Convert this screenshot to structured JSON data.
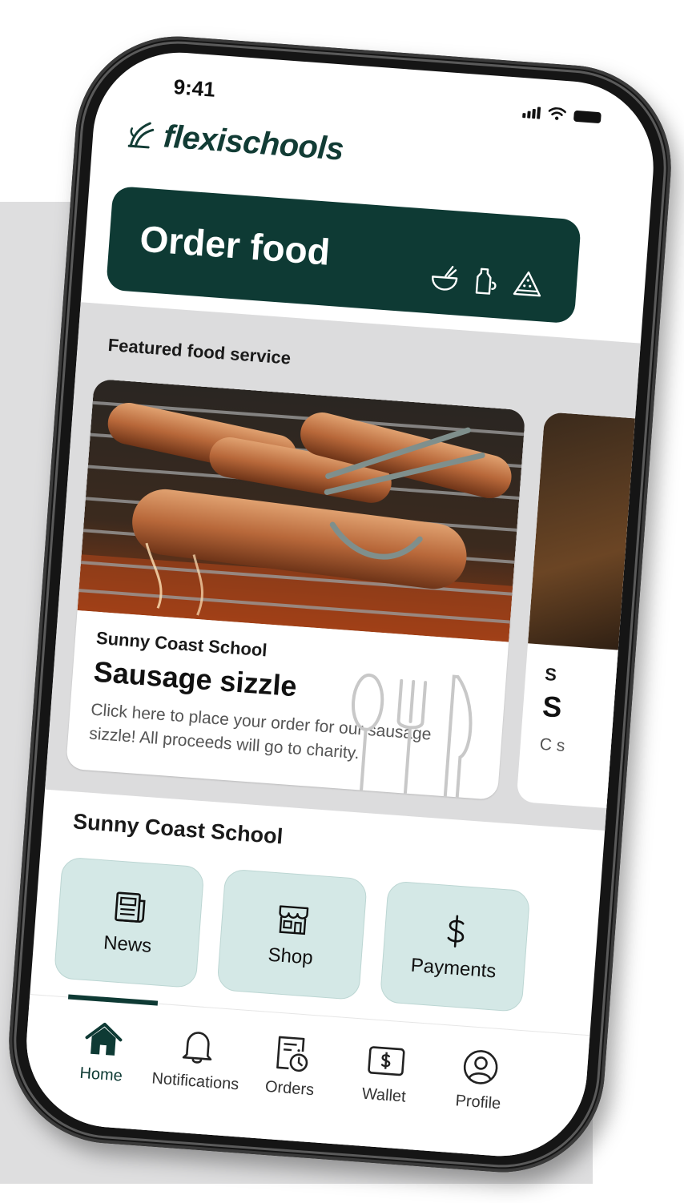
{
  "status_bar": {
    "time": "9:41"
  },
  "brand": {
    "name": "flexischools"
  },
  "order_banner": {
    "title": "Order food",
    "icons": [
      "bowl-icon",
      "bottle-icon",
      "watermelon-icon"
    ]
  },
  "featured": {
    "label": "Featured food service",
    "cards": [
      {
        "school": "Sunny Coast School",
        "title": "Sausage sizzle",
        "description": "Click here to place your order for our sausage sizzle! All proceeds will go to charity."
      },
      {
        "school": "S",
        "title": "S",
        "description": "C s"
      }
    ]
  },
  "school": {
    "heading": "Sunny Coast School",
    "tiles": [
      {
        "label": "News",
        "icon": "newspaper-icon"
      },
      {
        "label": "Shop",
        "icon": "store-icon"
      },
      {
        "label": "Payments",
        "icon": "dollar-icon"
      }
    ]
  },
  "tabs": [
    {
      "label": "Home",
      "icon": "home-icon",
      "active": true
    },
    {
      "label": "Notifications",
      "icon": "bell-icon",
      "active": false
    },
    {
      "label": "Orders",
      "icon": "orders-icon",
      "active": false
    },
    {
      "label": "Wallet",
      "icon": "wallet-icon",
      "active": false
    },
    {
      "label": "Profile",
      "icon": "profile-icon",
      "active": false
    }
  ],
  "colors": {
    "brand_dark": "#0e3a34",
    "tile_bg": "#d4e8e6",
    "section_bg": "#dcdcdd"
  }
}
